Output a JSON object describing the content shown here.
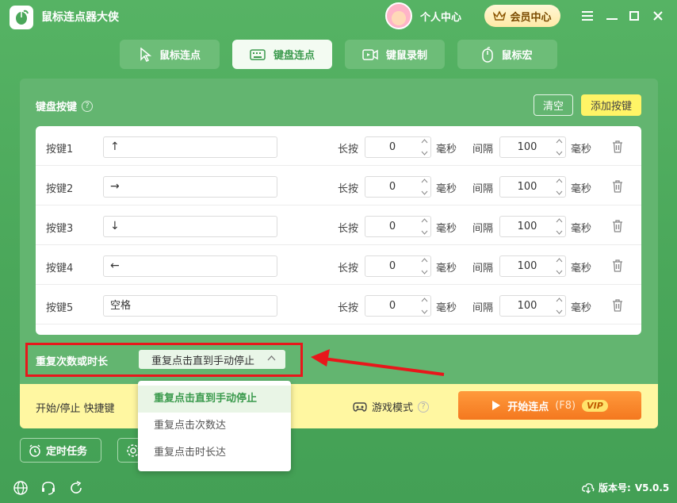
{
  "app": {
    "title": "鼠标连点器大侠"
  },
  "header": {
    "profile_label": "个人中心",
    "vip_label": "会员中心"
  },
  "tabs": [
    {
      "label": "鼠标连点",
      "icon": "cursor-icon",
      "active": false
    },
    {
      "label": "键盘连点",
      "icon": "keyboard-icon",
      "active": true
    },
    {
      "label": "键鼠录制",
      "icon": "video-record-icon",
      "active": false
    },
    {
      "label": "鼠标宏",
      "icon": "mouse-icon",
      "active": false
    }
  ],
  "keys_section": {
    "title": "键盘按键",
    "clear_label": "清空",
    "add_label": "添加按键"
  },
  "row_labels": {
    "hold": "长按",
    "interval": "间隔",
    "unit": "毫秒"
  },
  "keys": [
    {
      "name": "按键1",
      "key": "↑",
      "hold": "0",
      "interval": "100"
    },
    {
      "name": "按键2",
      "key": "→",
      "hold": "0",
      "interval": "100"
    },
    {
      "name": "按键3",
      "key": "↓",
      "hold": "0",
      "interval": "100"
    },
    {
      "name": "按键4",
      "key": "←",
      "hold": "0",
      "interval": "100"
    },
    {
      "name": "按键5",
      "key": "空格",
      "hold": "0",
      "interval": "100"
    }
  ],
  "repeat": {
    "label": "重复次数或时长",
    "selected": "重复点击直到手动停止",
    "options": [
      "重复点击直到手动停止",
      "重复点击次数达",
      "重复点击时长达"
    ]
  },
  "bottom": {
    "hotkey_label": "开始/停止 快捷键",
    "game_mode_label": "游戏模式",
    "start_label": "开始连点",
    "start_hotkey": "(F8)",
    "vip_badge": "VIP"
  },
  "tools": {
    "timer_label": "定时任务"
  },
  "footer": {
    "version_label": "版本号:",
    "version": "V5.0.5"
  },
  "colors": {
    "brand_green": "#4aa75a",
    "accent_yellow": "#fff466",
    "start_orange": "#f4781f",
    "annotation_red": "#e8171b"
  }
}
